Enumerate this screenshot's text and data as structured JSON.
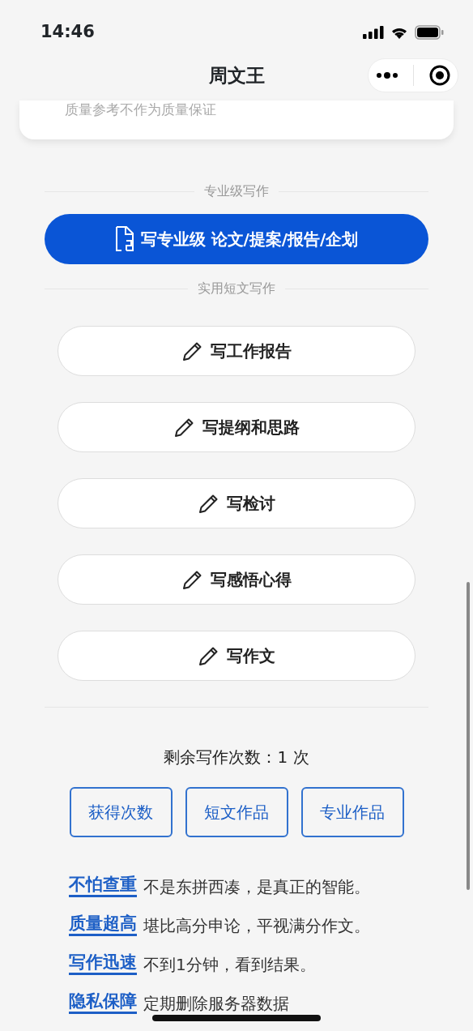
{
  "status_bar": {
    "time": "14:46"
  },
  "nav": {
    "title": "周文王"
  },
  "top_card": {
    "note": "质量参考不作为质量保证"
  },
  "pro_section": {
    "title": "专业级写作",
    "button": "写专业级 论文/提案/报告/企划"
  },
  "short_section": {
    "title": "实用短文写作",
    "buttons": [
      "写工作报告",
      "写提纲和思路",
      "写检讨",
      "写感悟心得",
      "写作文"
    ]
  },
  "remaining": "剩余写作次数：1 次",
  "actions": [
    "获得次数",
    "短文作品",
    "专业作品"
  ],
  "features": [
    {
      "tag": "不怕查重",
      "text": "不是东拼西凑，是真正的智能。"
    },
    {
      "tag": "质量超高",
      "text": "堪比高分申论，平视满分作文。"
    },
    {
      "tag": "写作迅速",
      "text": "不到1分钟，看到结果。"
    },
    {
      "tag": "隐私保障",
      "text": "定期删除服务器数据"
    }
  ]
}
